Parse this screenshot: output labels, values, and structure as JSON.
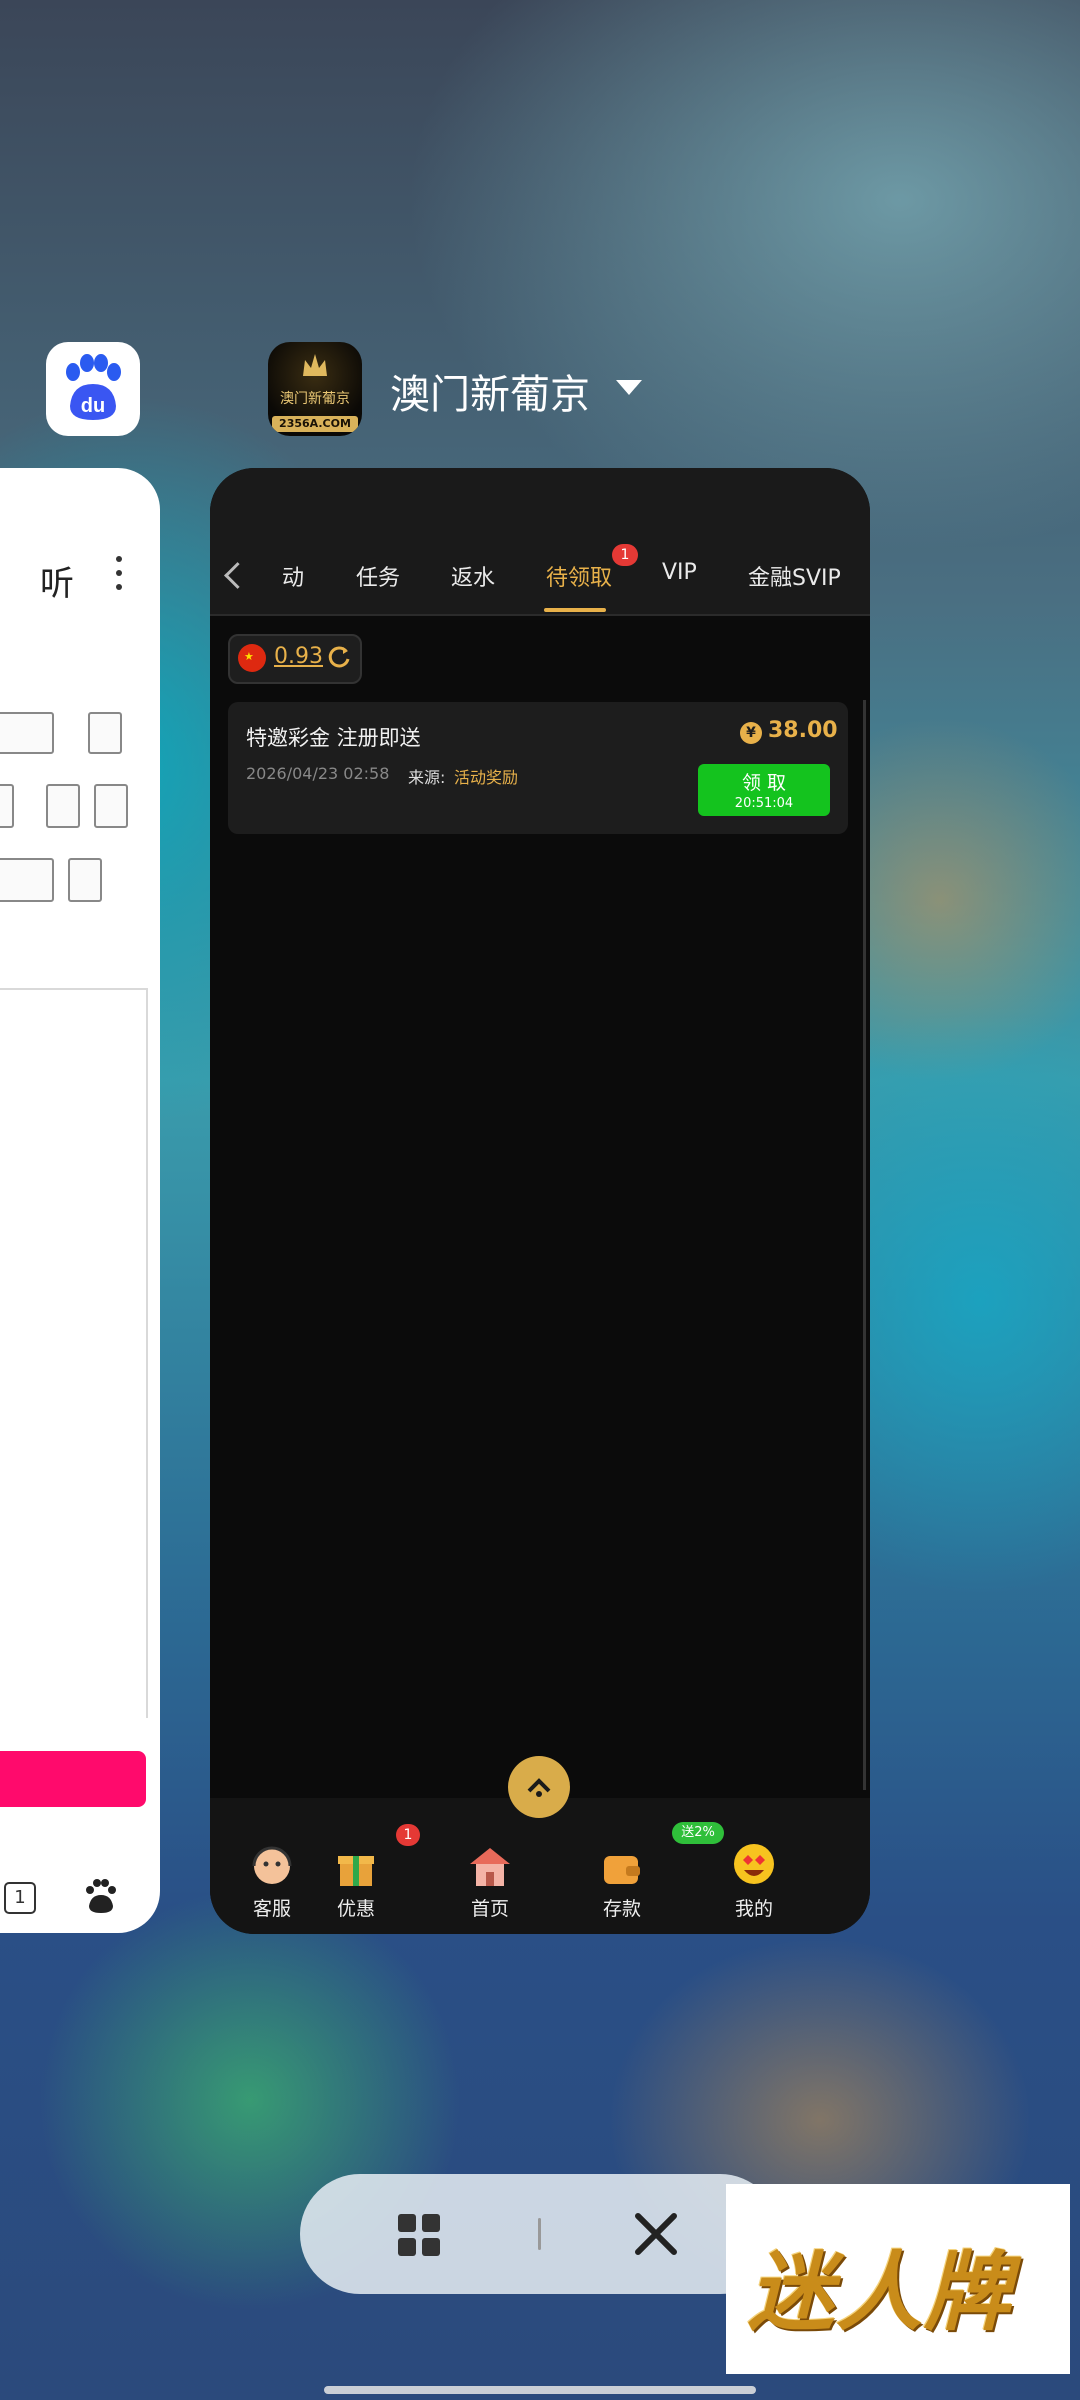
{
  "left_card": {
    "app_name": "Baidu",
    "icon_text": "du",
    "listen_label": "听",
    "tab_count": "1"
  },
  "main_app": {
    "title": "澳门新葡京",
    "icon_name": "澳门新葡京",
    "icon_domain": "2356A.COM",
    "tabs": [
      {
        "label": "动"
      },
      {
        "label": "任务"
      },
      {
        "label": "返水"
      },
      {
        "label": "待领取",
        "active": true,
        "badge": "1"
      },
      {
        "label": "VIP"
      },
      {
        "label": "金融SVIP"
      }
    ],
    "balance": "0.93",
    "reward": {
      "title": "特邀彩金 注册即送",
      "amount": "38.00",
      "date": "2026/04/23 02:58",
      "source_label": "来源:",
      "source_value": "活动奖励",
      "claim_label": "领 取",
      "countdown": "20:51:04"
    },
    "bottom_nav": [
      {
        "label": "客服",
        "icon": "customer-service-icon"
      },
      {
        "label": "优惠",
        "icon": "gift-icon",
        "badge": "1"
      },
      {
        "label": "首页",
        "icon": "home-icon"
      },
      {
        "label": "存款",
        "icon": "wallet-icon",
        "badge": "送2%"
      },
      {
        "label": "我的",
        "icon": "profile-emoji-icon"
      }
    ]
  },
  "watermark": {
    "text": "迷人牌"
  },
  "colors": {
    "accent_gold": "#e8b14a",
    "claim_green": "#14c31e",
    "badge_red": "#e53935",
    "baidu_pink": "#ff0a6c"
  }
}
